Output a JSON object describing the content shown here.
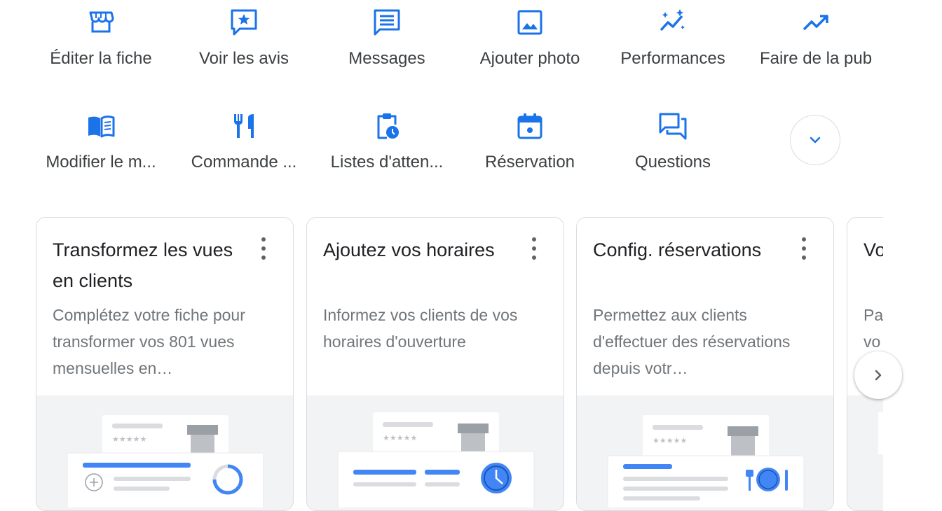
{
  "actions_row1": [
    {
      "label": "Éditer la fiche",
      "icon": "storefront-icon"
    },
    {
      "label": "Voir les avis",
      "icon": "star-review-icon"
    },
    {
      "label": "Messages",
      "icon": "message-icon"
    },
    {
      "label": "Ajouter photo",
      "icon": "photo-icon"
    },
    {
      "label": "Performances",
      "icon": "sparkle-chart-icon"
    },
    {
      "label": "Faire de la pub",
      "icon": "trending-up-icon"
    }
  ],
  "actions_row2": [
    {
      "label": "Modifier le m...",
      "icon": "menu-book-icon"
    },
    {
      "label": "Commande ...",
      "icon": "restaurant-icon"
    },
    {
      "label": "Listes d'atten...",
      "icon": "clipboard-clock-icon"
    },
    {
      "label": "Réservation",
      "icon": "calendar-icon"
    },
    {
      "label": "Questions",
      "icon": "forum-icon"
    }
  ],
  "expand_icon": "chevron-down-icon",
  "cards": [
    {
      "title": "Transformez les vues en clients",
      "description": "Complétez votre fiche pour transformer vos 801 vues mensuelles en…",
      "illustration": "progress"
    },
    {
      "title": "Ajoutez vos horaires",
      "description": "Informez vos clients de vos horaires d'ouverture",
      "illustration": "clock"
    },
    {
      "title": "Config. réservations",
      "description": "Permettez aux clients d'effectuer des réservations depuis votr…",
      "illustration": "dining"
    },
    {
      "title": "Vo",
      "description": "Pa vo",
      "illustration": "none"
    }
  ],
  "next_icon": "chevron-right-icon",
  "colors": {
    "accent": "#1a73e8",
    "card_border": "#dadce0",
    "illustration_bg": "#f1f3f4"
  }
}
